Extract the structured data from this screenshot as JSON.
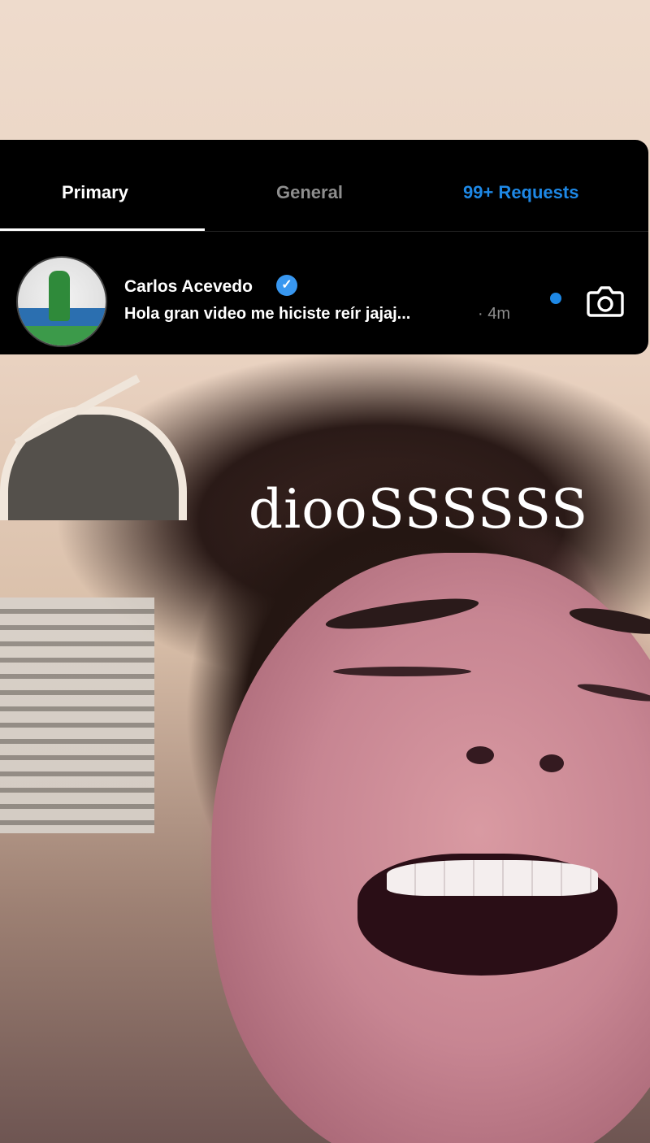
{
  "story": {
    "caption": "diooSSSSSS"
  },
  "inbox": {
    "tabs": [
      {
        "label": "Primary"
      },
      {
        "label": "General"
      },
      {
        "label": "99+ Requests"
      }
    ],
    "thread": {
      "name": "Carlos Acevedo",
      "verified": true,
      "preview": "Hola gran video me hiciste reír jajaj...",
      "time_prefix": "·",
      "time": "4m",
      "unread": true
    }
  },
  "colors": {
    "accent": "#1e88e5",
    "verified": "#3897f0",
    "card_bg": "#000000",
    "muted": "#8e8e8e"
  },
  "icons": {
    "verified": "verified-badge-icon",
    "camera": "camera-icon"
  }
}
